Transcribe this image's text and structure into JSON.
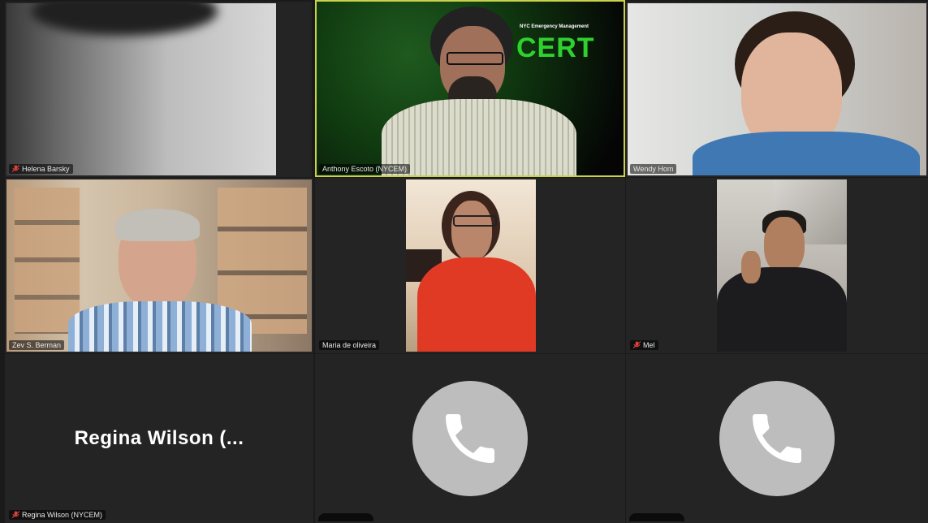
{
  "participants": [
    {
      "name": "Helena Barsky",
      "muted": true
    },
    {
      "name": "Anthony Escoto (NYCEM)",
      "muted": false,
      "active_speaker": true,
      "backdrop_text_top": "NYC Emergency Management",
      "backdrop_text_big": "CERT"
    },
    {
      "name": "Wendy Hom",
      "muted": false
    },
    {
      "name": "Zev S. Berman",
      "muted": false
    },
    {
      "name": "Maria de oliveira",
      "muted": false
    },
    {
      "name": "Mel",
      "muted": true
    },
    {
      "name": "Regina Wilson (NYCEM)",
      "display_label": "Regina Wilson (...",
      "muted": true
    },
    {
      "name": "",
      "phone": true
    },
    {
      "name": "",
      "phone": true
    }
  ],
  "colors": {
    "active_border": "#c9d24a",
    "muted_icon": "#e0403a",
    "phone_circle": "#bdbdbd",
    "background": "#1a1a1a"
  }
}
